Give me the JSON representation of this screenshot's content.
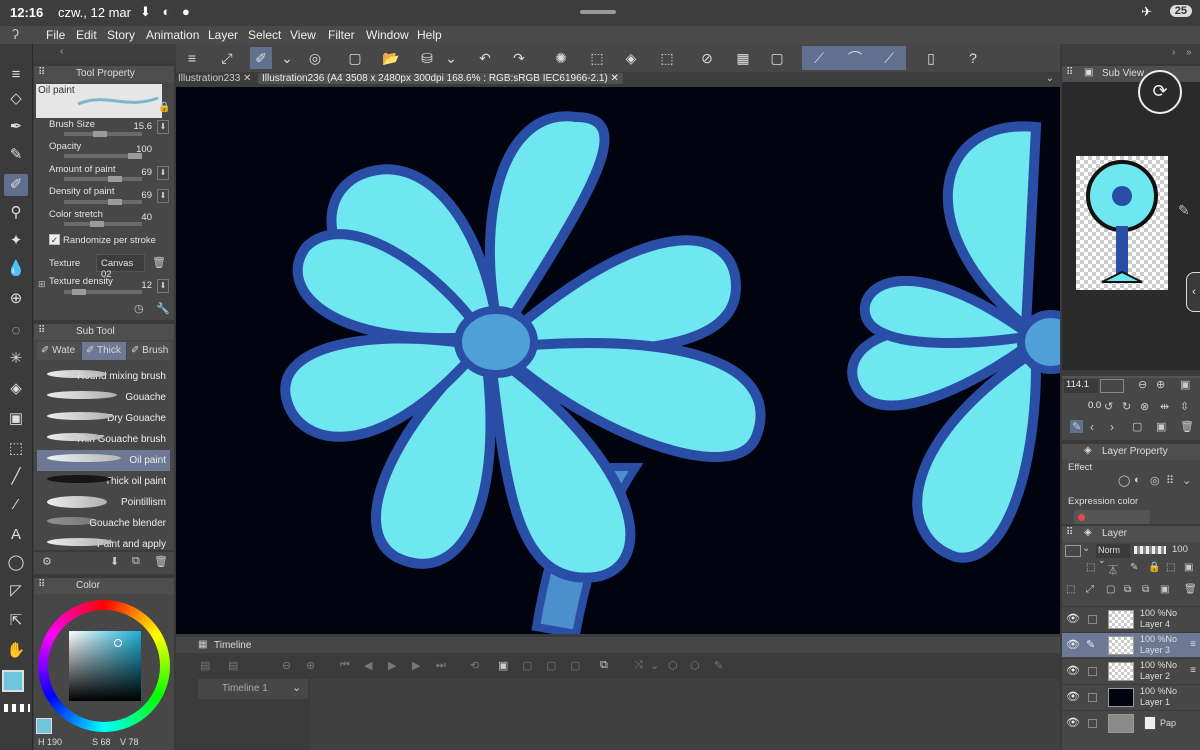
{
  "statusbar": {
    "time": "12:16",
    "date": "czw., 12 mar",
    "battery": "25"
  },
  "menu": [
    "File",
    "Edit",
    "Story",
    "Animation",
    "Layer",
    "Select",
    "View",
    "Filter",
    "Window",
    "Help"
  ],
  "tool_property": {
    "title": "Tool Property",
    "brush_name": "Oil paint",
    "fields": [
      {
        "label": "Brush Size",
        "value": "15.6",
        "level": 0.45
      },
      {
        "label": "Opacity",
        "value": "100",
        "level": 1.0
      },
      {
        "label": "Amount of paint",
        "value": "69",
        "level": 0.69
      },
      {
        "label": "Density of paint",
        "value": "69",
        "level": 0.69
      },
      {
        "label": "Color stretch",
        "value": "40",
        "level": 0.4
      }
    ],
    "randomize_label": "Randomize per stroke",
    "texture_label": "Texture",
    "texture_value": "Canvas 02",
    "texture_density_label": "Texture density",
    "texture_density_value": "12",
    "texture_density_level": 0.12
  },
  "sub_tool": {
    "title": "Sub Tool",
    "tabs": [
      "Wate",
      "Thick",
      "Brush"
    ],
    "brushes": [
      "Round mixing brush",
      "Gouache",
      "Dry Gouache",
      "Thin Gouache brush",
      "Oil paint",
      "Thick oil paint",
      "Pointillism",
      "Gouache blender",
      "Paint and apply"
    ],
    "selected_brush": "Oil paint"
  },
  "color": {
    "tab": "Color",
    "values": [
      "190",
      "68",
      "78"
    ],
    "main_color": "#6ec6dc"
  },
  "tabs": [
    {
      "label": "Illustration233"
    },
    {
      "label": "Illustration236 (A4 3508 x 2480px 300dpi 168.6% : RGB:sRGB IEC61966-2.1)"
    }
  ],
  "timeline": {
    "title": "Timeline",
    "name": "Timeline 1"
  },
  "sub_view": {
    "title": "Sub View",
    "zoom": "114.1",
    "angle": "0.0"
  },
  "layer_property": {
    "title": "Layer Property",
    "effect_label": "Effect",
    "expression_label": "Expression color"
  },
  "layer_panel": {
    "title": "Layer",
    "blend": "Norm",
    "opacity": "100",
    "layers": [
      {
        "opacity": "100 %No",
        "name": "Layer 4"
      },
      {
        "opacity": "100 %No",
        "name": "Layer 3"
      },
      {
        "opacity": "100 %No",
        "name": "Layer 2"
      },
      {
        "opacity": "100 %No",
        "name": "Layer 1"
      },
      {
        "opacity": "",
        "name": "Pap"
      }
    ],
    "selected_layer": "Layer 3"
  },
  "colors": {
    "canvas": "#01030e",
    "petal": "#6ee7f0",
    "outline": "#2a4ea6",
    "accent": "#61708f"
  }
}
